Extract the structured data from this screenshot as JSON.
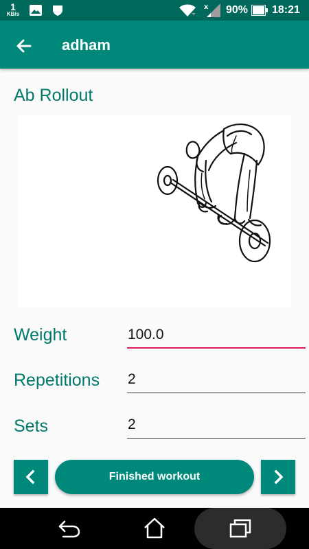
{
  "status_bar": {
    "net_speed": "1",
    "net_speed_unit": "KB/s",
    "battery": "90%",
    "time": "18:21",
    "icons": [
      "image-icon",
      "shield-icon",
      "wifi-icon",
      "signal-icon",
      "battery-icon"
    ],
    "battery_level": 0.9
  },
  "app_bar": {
    "title": "adham",
    "back_icon": "arrow-back-icon"
  },
  "exercise": {
    "name": "Ab Rollout",
    "image": "ab-rollout-illustration"
  },
  "form": {
    "weight_label": "Weight",
    "weight_value": "100.0",
    "reps_label": "Repetitions",
    "reps_value": "2",
    "sets_label": "Sets",
    "sets_value": "2"
  },
  "actions": {
    "prev_icon": "chevron-left-icon",
    "finish_label": "Finished workout",
    "next_icon": "chevron-right-icon"
  },
  "system_nav": {
    "icons": [
      "back-icon",
      "home-icon",
      "recent-apps-icon"
    ]
  },
  "colors": {
    "status_bar": "#00695c",
    "primary": "#00897b",
    "label_text": "#00796b",
    "focus_underline": "#d81b60"
  }
}
